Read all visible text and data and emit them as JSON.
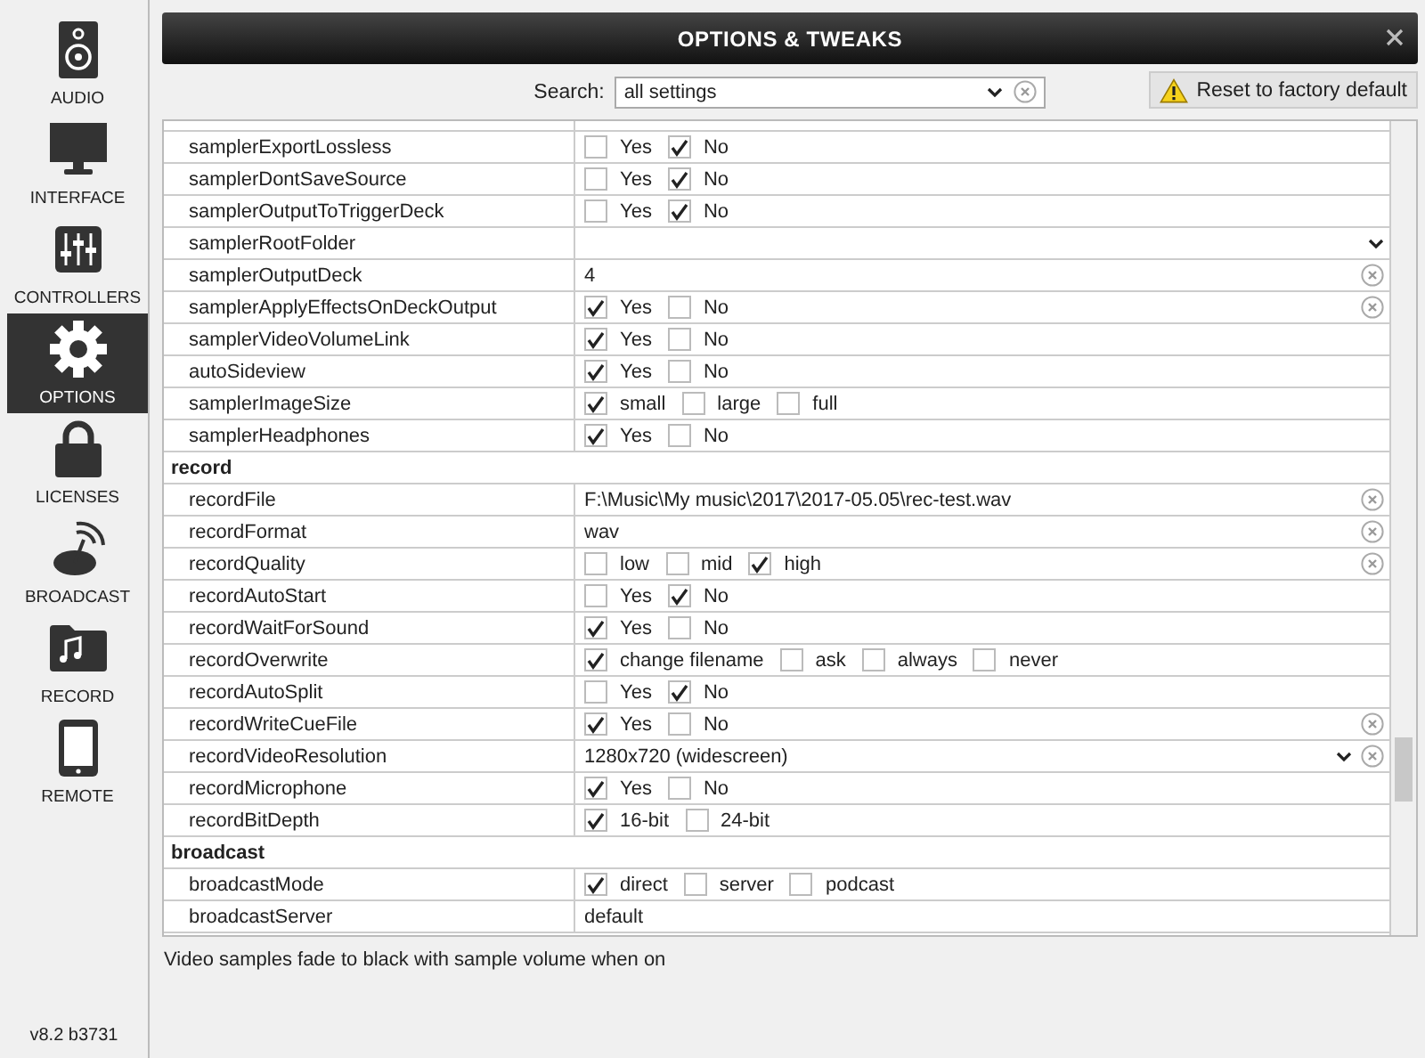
{
  "window": {
    "title": "OPTIONS & TWEAKS"
  },
  "sidebar": {
    "items": [
      {
        "label": "AUDIO",
        "kind": "speaker",
        "selected": false
      },
      {
        "label": "INTERFACE",
        "kind": "monitor",
        "selected": false
      },
      {
        "label": "CONTROLLERS",
        "kind": "sliders",
        "selected": false
      },
      {
        "label": "OPTIONS",
        "kind": "gear",
        "selected": true
      },
      {
        "label": "LICENSES",
        "kind": "lock",
        "selected": false
      },
      {
        "label": "BROADCAST",
        "kind": "dish",
        "selected": false
      },
      {
        "label": "RECORD",
        "kind": "folder",
        "selected": false
      },
      {
        "label": "REMOTE",
        "kind": "phone",
        "selected": false
      }
    ],
    "version": "v8.2 b3731"
  },
  "search": {
    "label": "Search:",
    "value": "all settings"
  },
  "reset_button": {
    "label": "Reset to factory default"
  },
  "groups": [
    {
      "rows": [
        {
          "name": "samplerExportLossless",
          "kind": "options",
          "clearable": false,
          "options": [
            {
              "label": "Yes",
              "checked": false
            },
            {
              "label": "No",
              "checked": true
            }
          ]
        },
        {
          "name": "samplerDontSaveSource",
          "kind": "options",
          "clearable": false,
          "options": [
            {
              "label": "Yes",
              "checked": false
            },
            {
              "label": "No",
              "checked": true
            }
          ]
        },
        {
          "name": "samplerOutputToTriggerDeck",
          "kind": "options",
          "clearable": false,
          "options": [
            {
              "label": "Yes",
              "checked": false
            },
            {
              "label": "No",
              "checked": true
            }
          ]
        },
        {
          "name": "samplerRootFolder",
          "kind": "dropdown",
          "clearable": false
        },
        {
          "name": "samplerOutputDeck",
          "kind": "text",
          "clearable": true,
          "value": "4"
        },
        {
          "name": "samplerApplyEffectsOnDeckOutput",
          "kind": "options",
          "clearable": true,
          "options": [
            {
              "label": "Yes",
              "checked": true
            },
            {
              "label": "No",
              "checked": false
            }
          ]
        },
        {
          "name": "samplerVideoVolumeLink",
          "kind": "options",
          "clearable": false,
          "options": [
            {
              "label": "Yes",
              "checked": true
            },
            {
              "label": "No",
              "checked": false
            }
          ]
        },
        {
          "name": "autoSideview",
          "kind": "options",
          "clearable": false,
          "options": [
            {
              "label": "Yes",
              "checked": true
            },
            {
              "label": "No",
              "checked": false
            }
          ]
        },
        {
          "name": "samplerImageSize",
          "kind": "options",
          "clearable": false,
          "options": [
            {
              "label": "small",
              "checked": true
            },
            {
              "label": "large",
              "checked": false
            },
            {
              "label": "full",
              "checked": false
            }
          ]
        },
        {
          "name": "samplerHeadphones",
          "kind": "options",
          "clearable": false,
          "options": [
            {
              "label": "Yes",
              "checked": true
            },
            {
              "label": "No",
              "checked": false
            }
          ]
        }
      ]
    },
    {
      "header": "record",
      "rows": [
        {
          "name": "recordFile",
          "kind": "text",
          "clearable": true,
          "value": "F:\\Music\\My music\\2017\\2017-05.05\\rec-test.wav"
        },
        {
          "name": "recordFormat",
          "kind": "text",
          "clearable": true,
          "value": "wav"
        },
        {
          "name": "recordQuality",
          "kind": "options",
          "clearable": true,
          "options": [
            {
              "label": "low",
              "checked": false
            },
            {
              "label": "mid",
              "checked": false
            },
            {
              "label": "high",
              "checked": true
            }
          ]
        },
        {
          "name": "recordAutoStart",
          "kind": "options",
          "clearable": false,
          "options": [
            {
              "label": "Yes",
              "checked": false
            },
            {
              "label": "No",
              "checked": true
            }
          ]
        },
        {
          "name": "recordWaitForSound",
          "kind": "options",
          "clearable": false,
          "options": [
            {
              "label": "Yes",
              "checked": true
            },
            {
              "label": "No",
              "checked": false
            }
          ]
        },
        {
          "name": "recordOverwrite",
          "kind": "options",
          "clearable": false,
          "options": [
            {
              "label": "change filename",
              "checked": true
            },
            {
              "label": "ask",
              "checked": false
            },
            {
              "label": "always",
              "checked": false
            },
            {
              "label": "never",
              "checked": false
            }
          ]
        },
        {
          "name": "recordAutoSplit",
          "kind": "options",
          "clearable": false,
          "options": [
            {
              "label": "Yes",
              "checked": false
            },
            {
              "label": "No",
              "checked": true
            }
          ]
        },
        {
          "name": "recordWriteCueFile",
          "kind": "options",
          "clearable": true,
          "options": [
            {
              "label": "Yes",
              "checked": true
            },
            {
              "label": "No",
              "checked": false
            }
          ]
        },
        {
          "name": "recordVideoResolution",
          "kind": "dropdown",
          "clearable": true,
          "value": "1280x720 (widescreen)"
        },
        {
          "name": "recordMicrophone",
          "kind": "options",
          "clearable": false,
          "options": [
            {
              "label": "Yes",
              "checked": true
            },
            {
              "label": "No",
              "checked": false
            }
          ]
        },
        {
          "name": "recordBitDepth",
          "kind": "options",
          "clearable": false,
          "options": [
            {
              "label": "16-bit",
              "checked": true
            },
            {
              "label": "24-bit",
              "checked": false
            }
          ]
        }
      ]
    },
    {
      "header": "broadcast",
      "rows": [
        {
          "name": "broadcastMode",
          "kind": "options",
          "clearable": false,
          "options": [
            {
              "label": "direct",
              "checked": true
            },
            {
              "label": "server",
              "checked": false
            },
            {
              "label": "podcast",
              "checked": false
            }
          ]
        },
        {
          "name": "broadcastServer",
          "kind": "text",
          "clearable": false,
          "value": "default"
        }
      ]
    }
  ],
  "description": "Video samples fade to black with sample volume when on"
}
